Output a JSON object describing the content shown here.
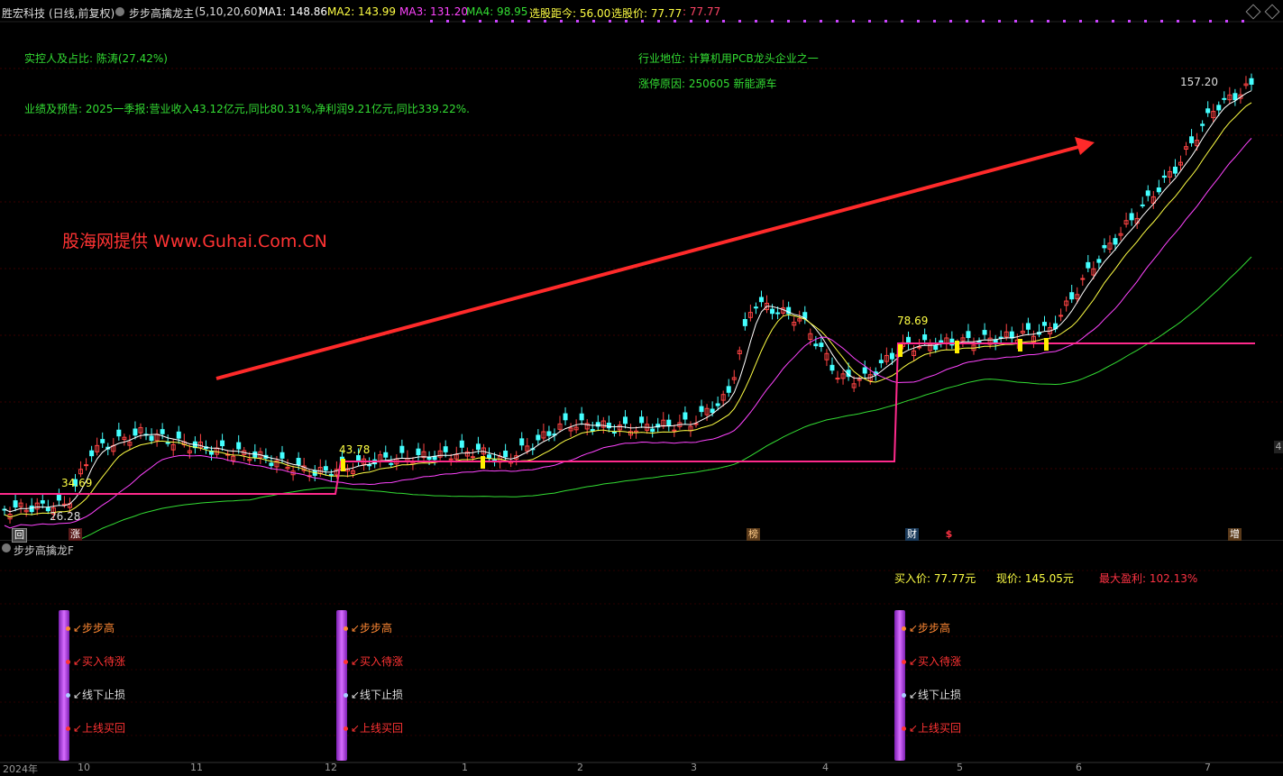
{
  "header": {
    "stock_name": "胜宏科技",
    "period": "(日线,前复权)",
    "indicator": "步步高擒龙主",
    "params": "(5,10,20,60)",
    "ma1": "MA1: 148.86",
    "ma2": "MA2: 143.99",
    "ma3": "MA3: 131.20",
    "ma4": "MA4: 98.95",
    "days": "选股距今: 56.00",
    "price": "选股价: 77.77",
    "price2": ": 77.77"
  },
  "annotations": {
    "controller": "实控人及占比: 陈涛(27.42%)",
    "performance": "业绩及预告: 2025一季报:营业收入43.12亿元,同比80.31%,净利润9.21亿元,同比339.22%.",
    "industry": "行业地位: 计算机用PCB龙头企业之一",
    "reason": "涨停原因: 250605 新能源车",
    "watermark": "股海网提供 Www.Guhai.Com.CN"
  },
  "price_labels": {
    "high": "157.20",
    "p1": "78.69",
    "p2": "43.78",
    "p3": "34.69",
    "low": "26.28"
  },
  "axis": {
    "right_tick": "4",
    "months": [
      "2024年",
      "10",
      "11",
      "12",
      "1",
      "2",
      "3",
      "4",
      "5",
      "6",
      "7"
    ]
  },
  "markers": {
    "hui": "回",
    "zhang": "涨",
    "bang": "榜",
    "cai": "财",
    "dollar": "$",
    "zeng": "增"
  },
  "sub_panel": {
    "title": "步步高擒龙F",
    "buy_price": "买入价: 77.77元",
    "current_price": "现价: 145.05元",
    "max_profit": "最大盈利: 102.13%",
    "signals": [
      "步步高",
      "买入待涨",
      "线下止损",
      "上线买回"
    ]
  },
  "colors": {
    "ma1": "#ffffff",
    "ma2": "#ffff44",
    "ma3": "#ff44ff",
    "ma4": "#33dd33",
    "up": "#ff4444",
    "down": "#44ffff",
    "step": "#ff2a8c"
  }
}
